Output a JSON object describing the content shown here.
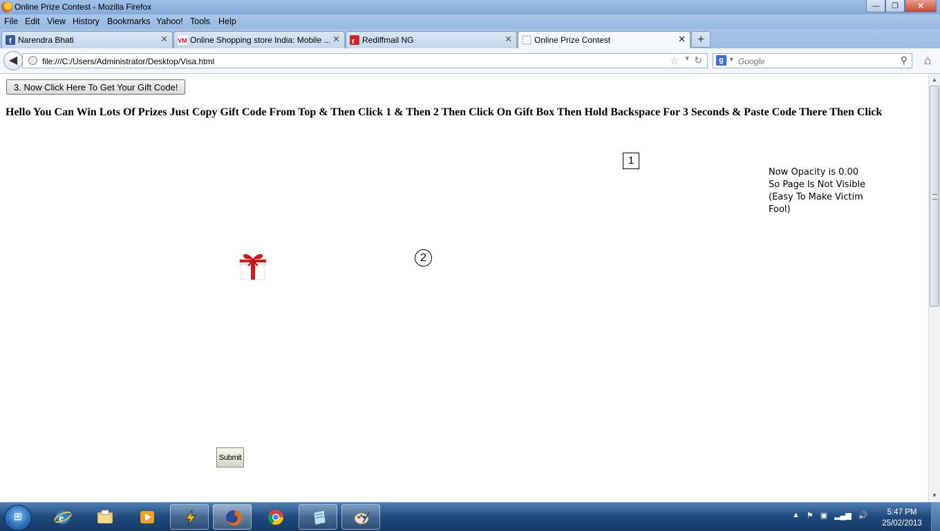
{
  "window": {
    "title": "Online Prize Contest - Mozilla Firefox",
    "buttons": {
      "minimize": "—",
      "maximize": "❐",
      "close": "✕"
    }
  },
  "menu": [
    "File",
    "Edit",
    "View",
    "History",
    "Bookmarks",
    "Yahoo!",
    "Tools",
    "Help"
  ],
  "tabs": [
    {
      "label": "Narendra Bhati",
      "icon": "facebook-icon",
      "active": false
    },
    {
      "label": "Online Shopping store India: Mobile ...",
      "icon": "vm-icon",
      "active": false
    },
    {
      "label": "Rediffmail NG",
      "icon": "rediff-icon",
      "active": false
    },
    {
      "label": "Online Prize Contest",
      "icon": "blank-page-icon",
      "active": true
    }
  ],
  "new_tab_label": "+",
  "nav": {
    "url": "file:///C:/Users/Administrator/Desktop/Visa.html",
    "search_placeholder": "Google"
  },
  "page": {
    "gift_code_button": "3. Now Click Here To Get Your Gift Code!",
    "instructions": "Hello You Can Win Lots Of Prizes Just Copy Gift Code From Top & Then Click 1 & Then 2 Then Click On Gift Box Then Hold Backspace For 3 Seconds & Paste Code There Then Click",
    "marker_1": "1",
    "marker_2": "2",
    "opacity_note": "Now Opacity is 0.00 So Page Is Not Visible (Easy To Make Victim Fool)",
    "submit_button": "Submit"
  },
  "taskbar": {
    "apps": [
      {
        "name": "internet-explorer",
        "state": "pinned"
      },
      {
        "name": "windows-explorer",
        "state": "pinned"
      },
      {
        "name": "media-player",
        "state": "pinned"
      },
      {
        "name": "winamp",
        "state": "running"
      },
      {
        "name": "firefox",
        "state": "active"
      },
      {
        "name": "chrome",
        "state": "pinned"
      },
      {
        "name": "notepad",
        "state": "running"
      },
      {
        "name": "paint",
        "state": "running"
      }
    ],
    "clock_time": "5:47 PM",
    "clock_date": "25/02/2013"
  },
  "colors": {
    "titlebar": "#9fc1e8",
    "taskbar": "#1f4a7c",
    "gift_red": "#d11a1a"
  }
}
